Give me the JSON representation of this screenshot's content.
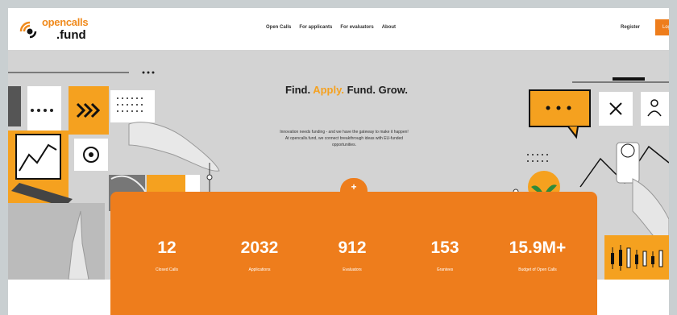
{
  "brand": {
    "name_top": "opencalls",
    "name_bottom": ".fund",
    "accent": "#ee7d1c"
  },
  "nav": {
    "items": [
      {
        "label": "Open Calls"
      },
      {
        "label": "For applicants"
      },
      {
        "label": "For evaluators"
      },
      {
        "label": "About"
      }
    ],
    "register_label": "Register",
    "login_label": "Log"
  },
  "hero": {
    "headline": {
      "part1": "Find.",
      "part2": "Apply.",
      "part3": "Fund. Grow."
    },
    "intro_line1": "Innovation needs funding - and we have the gateway to make it happen!",
    "intro_line2": "At opencalls.fund, we connect breakthrough ideas with EU-funded",
    "intro_line3": "opportunities."
  },
  "stats": [
    {
      "value": "12",
      "label": "Closed Calls"
    },
    {
      "value": "2032",
      "label": "Applications"
    },
    {
      "value": "912",
      "label": "Evaluators"
    },
    {
      "value": "153",
      "label": "Grantees"
    },
    {
      "value": "15.9M+",
      "label": "Budget of Open Calls"
    }
  ],
  "icons": {
    "left": [
      "laptop-chart-icon",
      "chevrons-right-icon",
      "target-circle-icon",
      "plant-icon",
      "hand-icon"
    ],
    "right": [
      "chat-bubble-icon",
      "close-x-icon",
      "user-icon",
      "smartphone-icon",
      "plant-icon",
      "candlestick-chart-icon"
    ]
  }
}
